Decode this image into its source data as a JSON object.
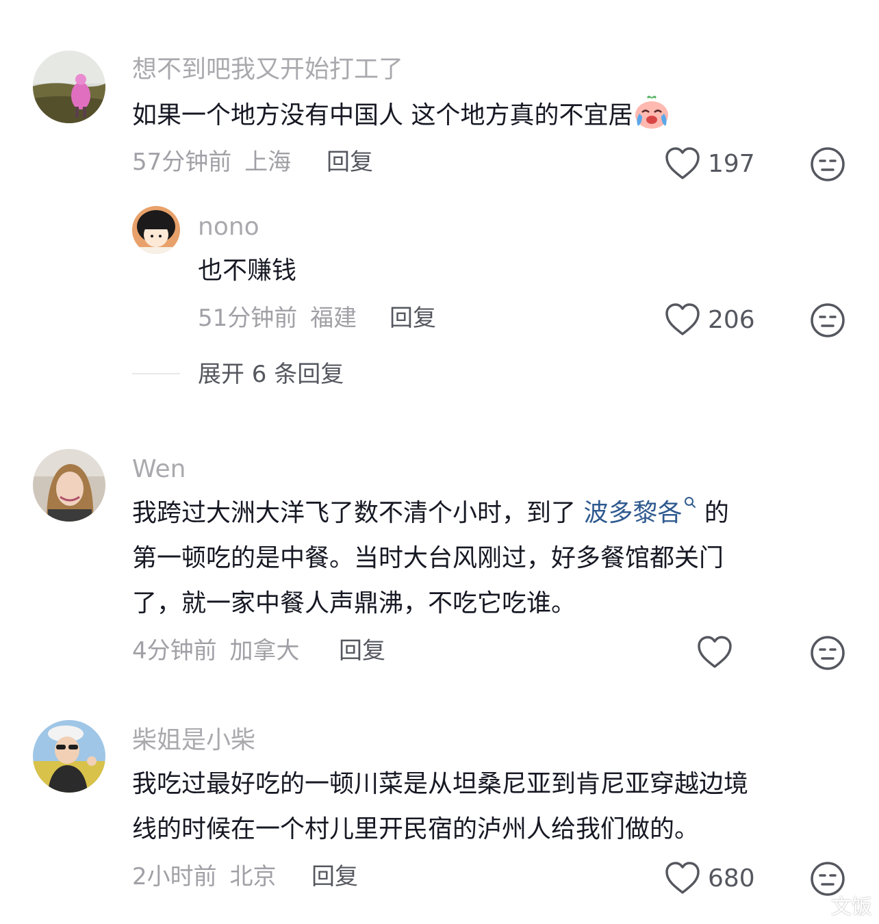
{
  "comments": [
    {
      "username": "想不到吧我又开始打工了",
      "text_line1": "如果一个地方没有中国人 这个地方真的不宜居",
      "emoji": "crying-laughing-emoji",
      "time": "57分钟前",
      "location": "上海",
      "reply_label": "回复",
      "likes": "197",
      "reply": {
        "username": "nono",
        "text": "也不赚钱",
        "time": "51分钟前",
        "location": "福建",
        "reply_label": "回复",
        "likes": "206"
      },
      "expand_label": "展开 6 条回复"
    },
    {
      "username": "Wen",
      "text_line1_pre": "我跨过大洲大洋飞了数不清个小时，到了 ",
      "text_link": "波多黎各",
      "text_line1_post": " 的",
      "text_line2": "第一顿吃的是中餐。当时大台风刚过，好多餐馆都关门",
      "text_line3": "了，就一家中餐人声鼎沸，不吃它吃谁。",
      "time": "4分钟前",
      "location": "加拿大",
      "reply_label": "回复",
      "likes": ""
    },
    {
      "username": "柴姐是小柴",
      "text_line1": "我吃过最好吃的一顿川菜是从坦桑尼亚到肯尼亚穿越边境",
      "text_line2": "线的时候在一个村儿里开民宿的泸州人给我们做的。",
      "time": "2小时前",
      "location": "北京",
      "reply_label": "回复",
      "likes": "680"
    }
  ],
  "watermark": "文饭",
  "colors": {
    "link": "#2f5a8f",
    "text": "#161823",
    "meta": "#a0a0a6"
  }
}
